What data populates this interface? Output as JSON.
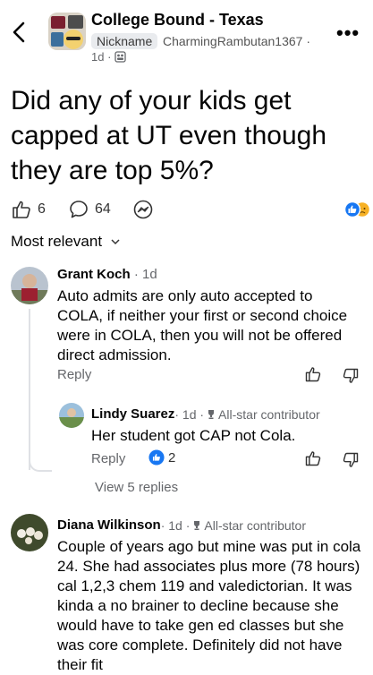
{
  "header": {
    "group_name": "College Bound - Texas",
    "nickname_badge": "Nickname",
    "author": "CharmingRambutan1367 ·",
    "time": "1d ·"
  },
  "post": {
    "title": "Did any of your kids get capped at UT even though they are top 5%?",
    "likes": "6",
    "comments": "64"
  },
  "sort": {
    "label": "Most relevant"
  },
  "comments": [
    {
      "name": "Grant Koch",
      "time": " · 1d",
      "text": "Auto admits are only auto accepted to COLA, if neither your first or second choice were in COLA, then you will not be offered direct admission.",
      "reply_label": "Reply"
    },
    {
      "name": "Lindy Suarez",
      "time": " · 1d · ",
      "badge": "All-star contributor",
      "text": "Her student got CAP not Cola.",
      "reply_label": "Reply",
      "likes": "2",
      "view_replies": "View 5 replies"
    },
    {
      "name": "Diana Wilkinson",
      "time": " · 1d · ",
      "badge": "All-star contributor",
      "text": "Couple of years ago but mine was put in cola 24. She had associates plus more (78 hours) cal 1,2,3 chem 119 and valedictorian. It was kinda a no brainer to decline because she would have to take gen ed classes but she was core complete. Definitely did not have their fit"
    }
  ],
  "colors": {
    "link_blue": "#1877f2",
    "secondary": "#65676b",
    "reaction_yellow": "#f7b125"
  },
  "icons": [
    "back-chevron-icon",
    "more-dots-icon",
    "like-thumb-icon",
    "comment-bubble-icon",
    "messenger-icon",
    "trophy-icon"
  ]
}
